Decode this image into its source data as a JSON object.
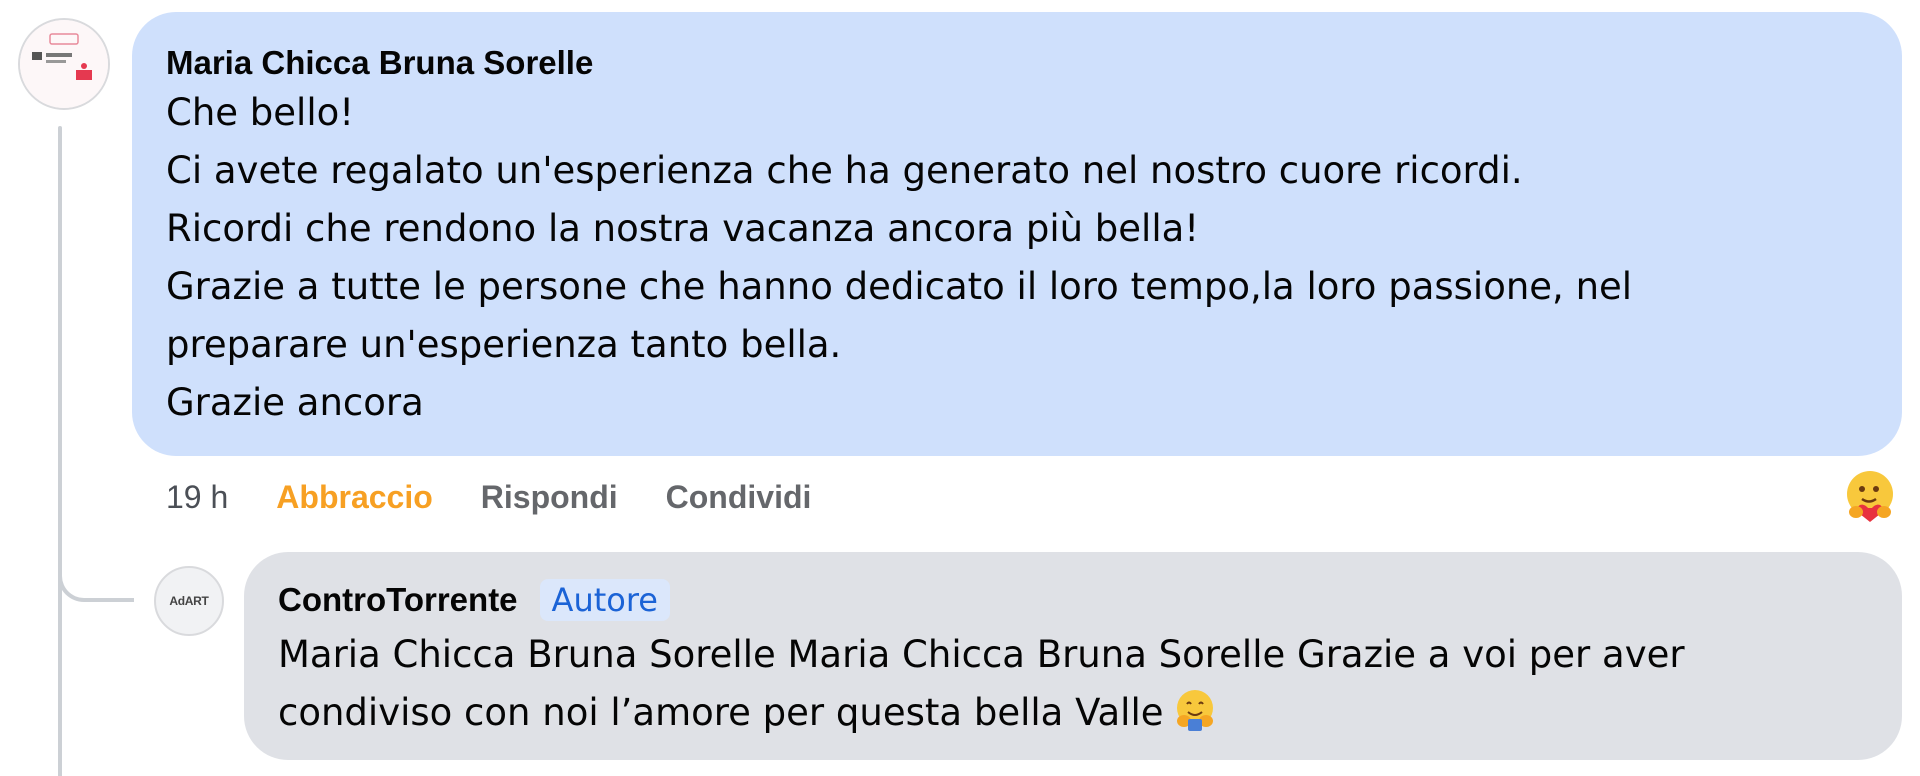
{
  "comment": {
    "author": "Maria Chicca Bruna Sorelle",
    "lines": [
      "Che bello!",
      "Ci avete regalato un'esperienza che ha generato nel nostro cuore ricordi.",
      "Ricordi che rendono la nostra vacanza ancora più bella!",
      "Grazie a tutte le persone che hanno dedicato il loro tempo,la loro passione, nel",
      "preparare un'esperienza tanto bella.",
      "Grazie ancora"
    ],
    "time": "19 h",
    "actions": {
      "react": "Abbraccio",
      "reply": "Rispondi",
      "share": "Condividi"
    },
    "reaction_icon": "care-hug-icon",
    "reaction_color": "#f7a023"
  },
  "reply": {
    "author": "ControTorrente",
    "badge": "Autore",
    "avatar_text": "AdART",
    "lines": [
      "Maria Chicca Bruna Sorelle Maria Chicca Bruna Sorelle Grazie a voi per aver",
      "condiviso con noi l’amore per questa bella Valle"
    ],
    "emoji": "hugging-face-icon"
  },
  "colors": {
    "comment_bubble": "#cfe0fc",
    "reply_bubble": "#dfe1e6",
    "badge_text": "#1b63d6",
    "badge_bg": "#dbe7fb"
  }
}
